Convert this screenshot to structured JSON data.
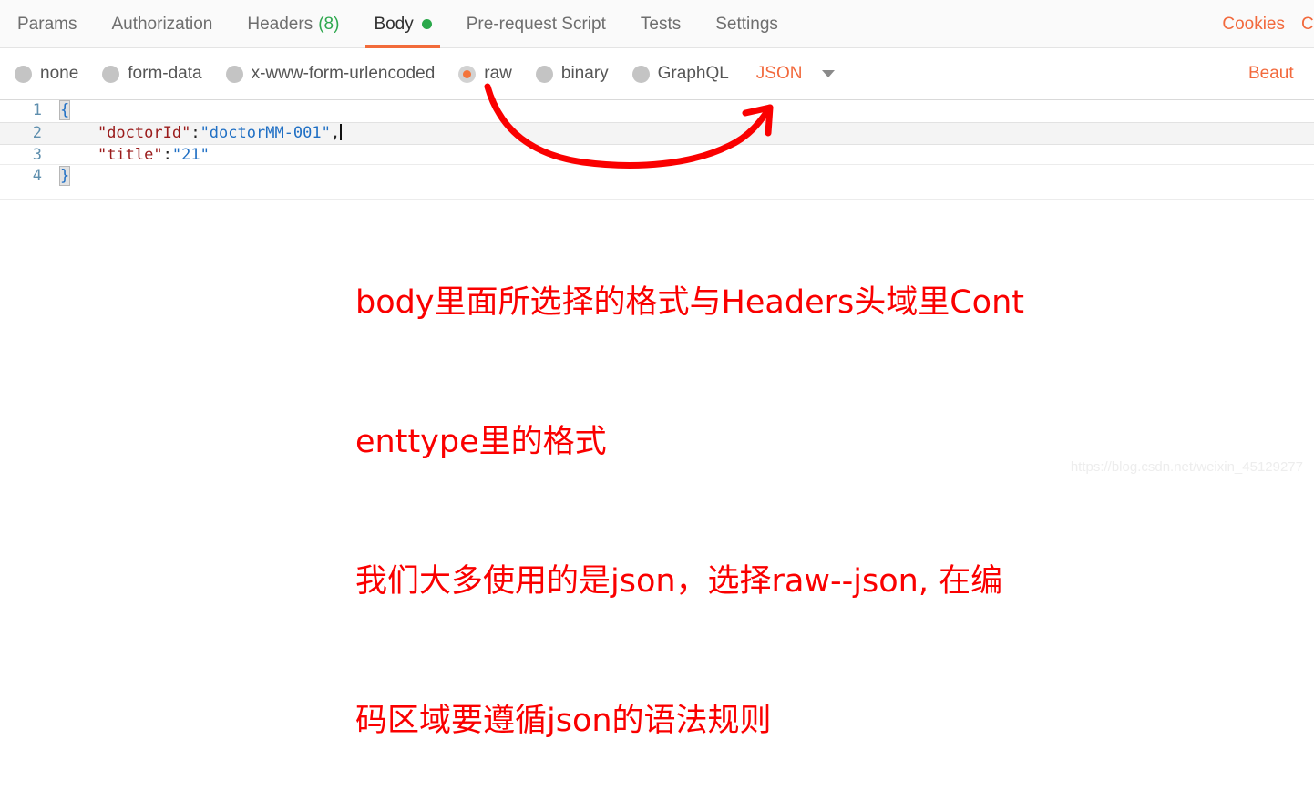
{
  "tabbar": {
    "tabs": [
      {
        "label": "Params",
        "active": false
      },
      {
        "label": "Authorization",
        "active": false
      },
      {
        "label": "Headers",
        "count": "(8)",
        "active": false
      },
      {
        "label": "Body",
        "active": true,
        "dot": "green-status-dot"
      },
      {
        "label": "Pre-request Script",
        "active": false
      },
      {
        "label": "Tests",
        "active": false
      },
      {
        "label": "Settings",
        "active": false
      }
    ],
    "cookies_label": "Cookies",
    "code_label": "C"
  },
  "body_type": {
    "options": [
      {
        "label": "none",
        "selected": false
      },
      {
        "label": "form-data",
        "selected": false
      },
      {
        "label": "x-www-form-urlencoded",
        "selected": false
      },
      {
        "label": "raw",
        "selected": true
      },
      {
        "label": "binary",
        "selected": false
      },
      {
        "label": "GraphQL",
        "selected": false
      }
    ],
    "format_value": "JSON",
    "chevron": "chevron-down-icon",
    "beautify_label": "Beaut"
  },
  "editor": {
    "lines": [
      {
        "number": "1",
        "brace": "{",
        "active": false
      },
      {
        "number": "2",
        "key": "\"doctorId\"",
        "colon": ":",
        "value": "\"doctorMM-001\"",
        "comma": ",",
        "active": true
      },
      {
        "number": "3",
        "key": "\"title\"",
        "colon": ":",
        "value": "\"21\"",
        "comma": "",
        "active": false
      },
      {
        "number": "4",
        "brace": "}",
        "active": false
      }
    ]
  },
  "annotation": {
    "color": "#fa0000",
    "lines": [
      "body里面所选择的格式与Headers头域里Cont",
      "enttype里的格式",
      "我们大多使用的是json，选择raw--json, 在编",
      "码区域要遵循json的语法规则"
    ],
    "arrow": "curved-arrow-raw-to-json"
  },
  "watermark": {
    "text": "https://blog.csdn.net/weixin_45129277"
  }
}
